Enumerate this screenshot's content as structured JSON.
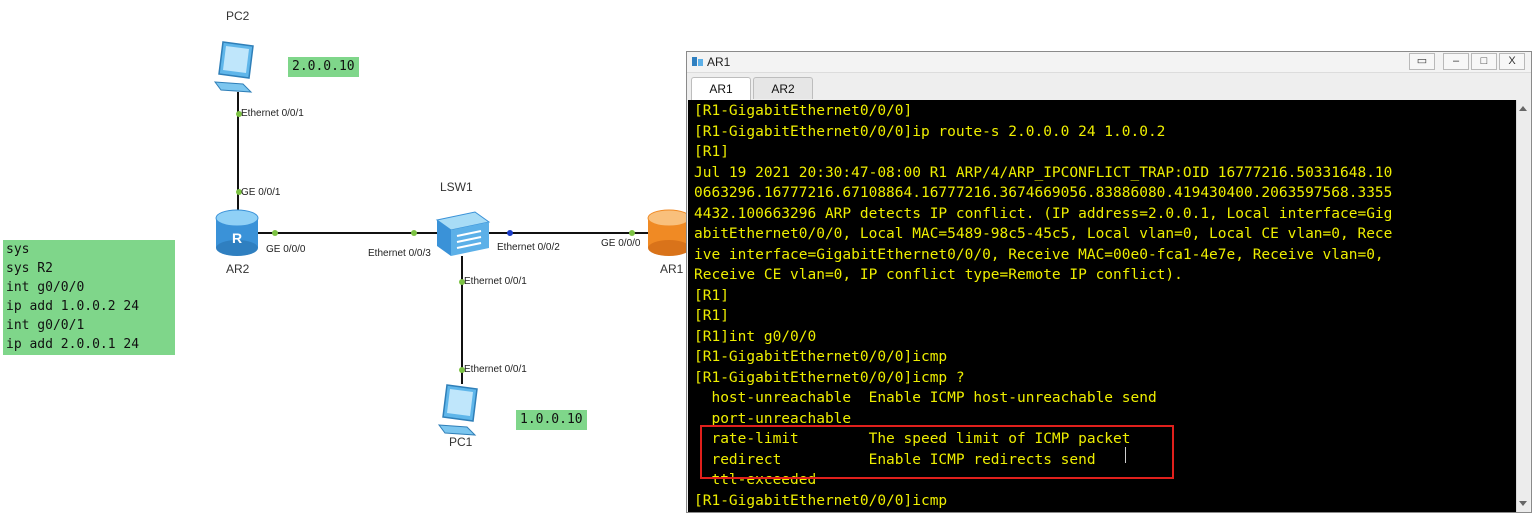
{
  "topology": {
    "devices": {
      "pc2": "PC2",
      "pc1": "PC1",
      "ar2": "AR2",
      "ar1": "AR1",
      "lsw1": "LSW1"
    },
    "ports": {
      "pc2_eth": "Ethernet 0/0/1",
      "ar2_ge001": "GE 0/0/1",
      "ar2_ge000": "GE 0/0/0",
      "lsw_e003": "Ethernet 0/0/3",
      "lsw_e002": "Ethernet 0/0/2",
      "ar1_ge000": "GE 0/0/0",
      "lsw_e001": "Ethernet 0/0/1",
      "pc1_eth": "Ethernet 0/0/1"
    },
    "ip_labels": {
      "pc2": "2.0.0.10",
      "pc1": "1.0.0.10"
    }
  },
  "config_note": [
    "sys",
    "sys R2",
    "int g0/0/0",
    "ip add 1.0.0.2 24",
    "int g0/0/1",
    "ip add 2.0.0.1 24"
  ],
  "window": {
    "title": "AR1",
    "tabs": [
      "AR1",
      "AR2"
    ],
    "active_tab": "AR1",
    "buttons": {
      "restore": "▭",
      "minimize": "–",
      "maximize": "□",
      "close": "X"
    }
  },
  "terminal": {
    "lines": [
      "[R1-GigabitEthernet0/0/0]",
      "[R1-GigabitEthernet0/0/0]ip route-s 2.0.0.0 24 1.0.0.2",
      "[R1]",
      "Jul 19 2021 20:30:47-08:00 R1 ARP/4/ARP_IPCONFLICT_TRAP:OID 16777216.50331648.10",
      "0663296.16777216.67108864.16777216.3674669056.83886080.419430400.2063597568.3355",
      "4432.100663296 ARP detects IP conflict. (IP address=2.0.0.1, Local interface=Gig",
      "abitEthernet0/0/0, Local MAC=5489-98c5-45c5, Local vlan=0, Local CE vlan=0, Rece",
      "ive interface=GigabitEthernet0/0/0, Receive MAC=00e0-fca1-4e7e, Receive vlan=0,",
      "Receive CE vlan=0, IP conflict type=Remote IP conflict).",
      "[R1]",
      "[R1]",
      "[R1]int g0/0/0",
      "[R1-GigabitEthernet0/0/0]icmp",
      "[R1-GigabitEthernet0/0/0]icmp ?",
      "  host-unreachable  Enable ICMP host-unreachable send",
      "  port-unreachable",
      "  rate-limit        The speed limit of ICMP packet",
      "  redirect          Enable ICMP redirects send",
      "  ttl-exceeded",
      "[R1-GigabitEthernet0/0/0]icmp"
    ]
  },
  "colors": {
    "terminal_bg": "#000000",
    "terminal_fg": "#eeee00",
    "note_bg": "#7fd68a",
    "highlight_box": "#e0201c",
    "link_line": "#111111",
    "port_dot": "#7cc243"
  }
}
